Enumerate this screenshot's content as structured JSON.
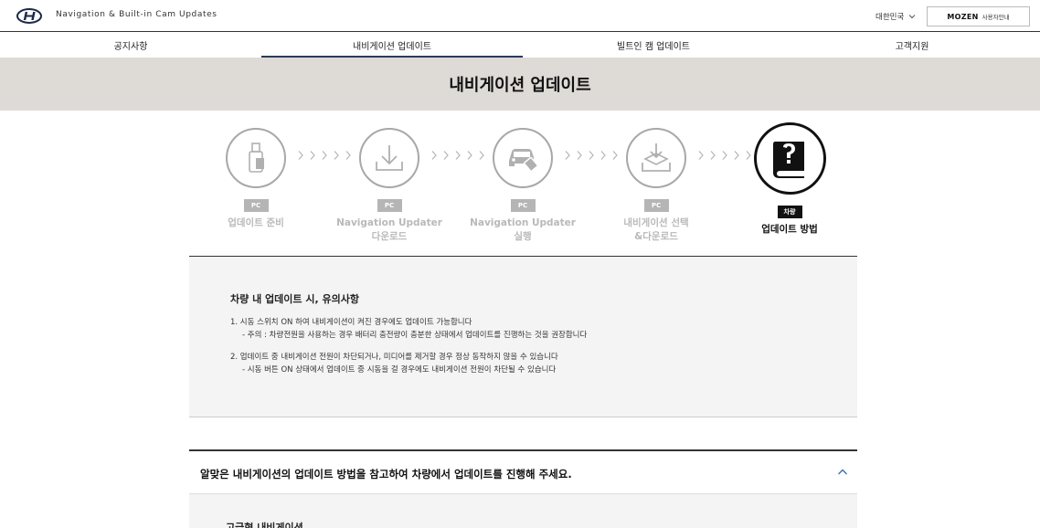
{
  "header": {
    "site_title": "Navigation & Built-in Cam Updates",
    "country": "대한민국",
    "mozen_logo": "MOZEN",
    "mozen_label": "사용자안내"
  },
  "nav": {
    "items": [
      {
        "label": "공지사항"
      },
      {
        "label": "내비게이션 업데이트"
      },
      {
        "label": "빌트인 캠 업데이트"
      },
      {
        "label": "고객지원"
      }
    ],
    "active_index": 1
  },
  "page": {
    "title": "내비게이션 업데이트"
  },
  "steps": [
    {
      "badge": "PC",
      "label_line1": "업데이트 준비",
      "label_line2": "",
      "icon": "usb-drive-icon",
      "active": false
    },
    {
      "badge": "PC",
      "label_line1": "Navigation Updater",
      "label_line2": "다운로드",
      "icon": "download-icon",
      "active": false
    },
    {
      "badge": "PC",
      "label_line1": "Navigation Updater",
      "label_line2": "실행",
      "icon": "car-usb-icon",
      "active": false
    },
    {
      "badge": "PC",
      "label_line1": "내비게이션 선택",
      "label_line2": "&다운로드",
      "icon": "download-tray-icon",
      "active": false
    },
    {
      "badge": "차량",
      "label_line1": "업데이트 방법",
      "label_line2": "",
      "icon": "question-book-icon",
      "active": true
    }
  ],
  "notice": {
    "title": "차량 내 업데이트 시, 유의사항",
    "lines": [
      "1. 시동 스위치 ON 하여 내비게이션이 켜진 경우에도 업데이트 가능합니다",
      "- 주의 : 차량전원을 사용하는 경우 배터리 충전량이 충분한 상태에서 업데이트를 진행하는 것을 권장합니다",
      "2. 업데이트 중 내비게이션 전원이 차단되거나, 미디어를 제거할 경우 정상 동작하지 않을 수 있습니다",
      "- 시동 버튼 ON 상태에서 업데이트 중 시동을 걸 경우에도 내비게이션 전원이 차단될 수 있습니다"
    ]
  },
  "accordion": {
    "title": "알맞은 내비게이션의 업데이트 방법을 참고하여 차량에서 업데이트를 진행해 주세요.",
    "expanded": true,
    "body_title": "고급형 내비게이션"
  },
  "colors": {
    "band_bg": "#dedad6",
    "active_underline": "#2a3b55",
    "inactive_step": "#b5b5b5",
    "active_step": "#111111"
  }
}
